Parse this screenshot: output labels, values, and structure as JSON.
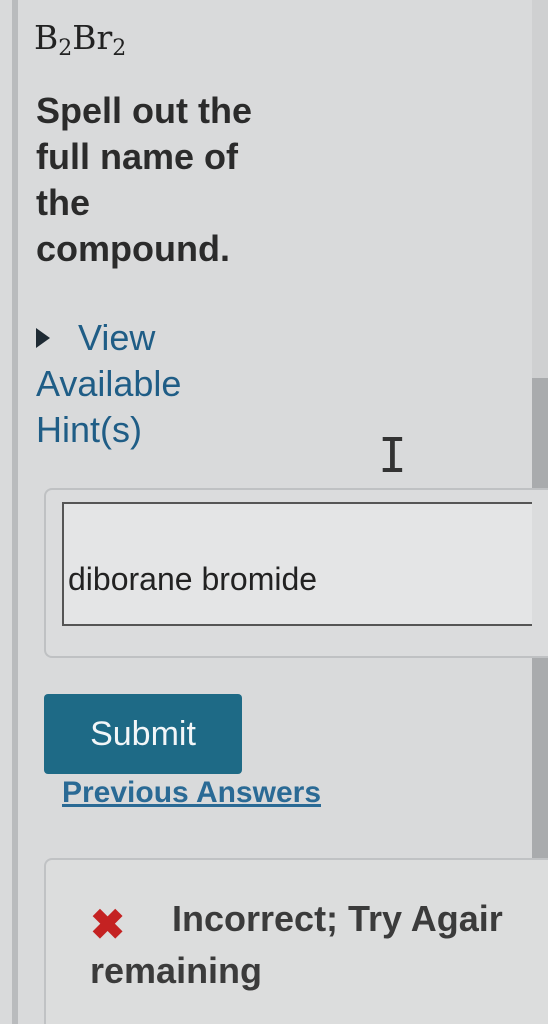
{
  "question": {
    "formula": {
      "el1": "B",
      "sub1": "2",
      "el2": "Br",
      "sub2": "2"
    },
    "prompt": "Spell out the full name of the compound."
  },
  "hints": {
    "icon": "triangle-right-icon",
    "label": "View Available Hint(s)"
  },
  "cursor": {
    "glyph": "I"
  },
  "answer": {
    "value": "diborane bromide"
  },
  "actions": {
    "submit_label": "Submit",
    "previous_answers_label": "Previous Answers",
    "submit_color": "#1e6a86"
  },
  "feedback": {
    "icon": "x-mark-icon",
    "icon_glyph": "✖",
    "status": "Incorrect; Try Agair",
    "remaining": "remaining",
    "status_color": "#c42222"
  }
}
